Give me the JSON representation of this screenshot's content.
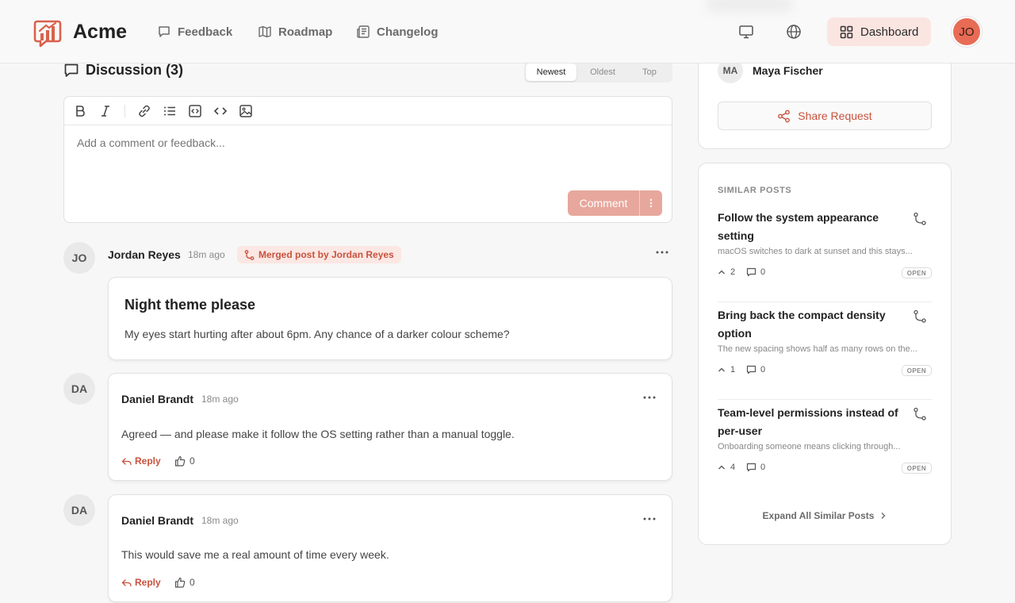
{
  "header": {
    "brand": "Acme",
    "nav": [
      {
        "label": "Feedback",
        "icon": "speech-bubble-icon"
      },
      {
        "label": "Roadmap",
        "icon": "map-icon"
      },
      {
        "label": "Changelog",
        "icon": "newspaper-icon"
      }
    ],
    "dashboard_label": "Dashboard",
    "user_initials": "JO"
  },
  "discussion": {
    "title": "Discussion (3)",
    "sort_tabs": [
      "Newest",
      "Oldest",
      "Top"
    ],
    "active_sort": "Newest",
    "editor_placeholder": "Add a comment or feedback...",
    "comment_button": "Comment"
  },
  "merged_post": {
    "author_initials": "JO",
    "author": "Jordan Reyes",
    "time": "18m ago",
    "badge": "Merged post by Jordan Reyes",
    "title": "Night theme please",
    "body": "My eyes start hurting after about 6pm. Any chance of a darker colour scheme?"
  },
  "comments": [
    {
      "initials": "DA",
      "author": "Daniel Brandt",
      "time": "18m ago",
      "body": "Agreed — and please make it follow the OS setting rather than a manual toggle.",
      "reply_label": "Reply",
      "likes": "0"
    },
    {
      "initials": "DA",
      "author": "Daniel Brandt",
      "time": "18m ago",
      "body": "This would save me a real amount of time every week.",
      "reply_label": "Reply",
      "likes": "0"
    }
  ],
  "sidebar": {
    "follower_initials": "MA",
    "follower_name": "Maya Fischer",
    "share_label": "Share Request",
    "similar_heading": "SIMILAR POSTS",
    "similar_posts": [
      {
        "title": "Follow the system appearance setting",
        "desc": "macOS switches to dark at sunset and this stays...",
        "votes": "2",
        "comments": "0",
        "status": "OPEN"
      },
      {
        "title": "Bring back the compact density option",
        "desc": "The new spacing shows half as many rows on the...",
        "votes": "1",
        "comments": "0",
        "status": "OPEN"
      },
      {
        "title": "Team-level permissions instead of per-user",
        "desc": "Onboarding someone means clicking through...",
        "votes": "4",
        "comments": "0",
        "status": "OPEN"
      }
    ],
    "expand_label": "Expand All Similar Posts"
  },
  "colors": {
    "accent": "#c8523e",
    "accent_soft": "#fbe5e1",
    "avatar": "#e86b55"
  }
}
